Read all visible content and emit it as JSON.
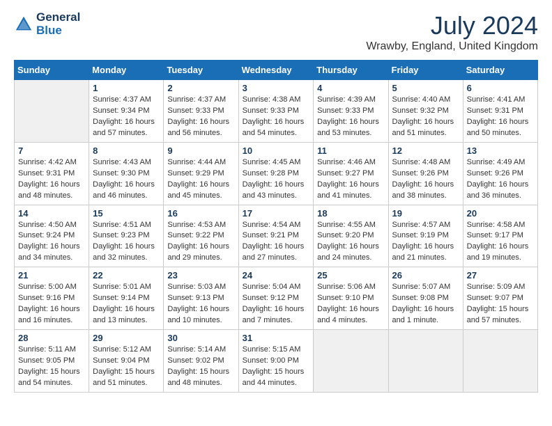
{
  "header": {
    "logo_line1": "General",
    "logo_line2": "Blue",
    "month_year": "July 2024",
    "location": "Wrawby, England, United Kingdom"
  },
  "columns": [
    "Sunday",
    "Monday",
    "Tuesday",
    "Wednesday",
    "Thursday",
    "Friday",
    "Saturday"
  ],
  "weeks": [
    [
      {
        "day": "",
        "sunrise": "",
        "sunset": "",
        "daylight": ""
      },
      {
        "day": "1",
        "sunrise": "Sunrise: 4:37 AM",
        "sunset": "Sunset: 9:34 PM",
        "daylight": "Daylight: 16 hours and 57 minutes."
      },
      {
        "day": "2",
        "sunrise": "Sunrise: 4:37 AM",
        "sunset": "Sunset: 9:33 PM",
        "daylight": "Daylight: 16 hours and 56 minutes."
      },
      {
        "day": "3",
        "sunrise": "Sunrise: 4:38 AM",
        "sunset": "Sunset: 9:33 PM",
        "daylight": "Daylight: 16 hours and 54 minutes."
      },
      {
        "day": "4",
        "sunrise": "Sunrise: 4:39 AM",
        "sunset": "Sunset: 9:33 PM",
        "daylight": "Daylight: 16 hours and 53 minutes."
      },
      {
        "day": "5",
        "sunrise": "Sunrise: 4:40 AM",
        "sunset": "Sunset: 9:32 PM",
        "daylight": "Daylight: 16 hours and 51 minutes."
      },
      {
        "day": "6",
        "sunrise": "Sunrise: 4:41 AM",
        "sunset": "Sunset: 9:31 PM",
        "daylight": "Daylight: 16 hours and 50 minutes."
      }
    ],
    [
      {
        "day": "7",
        "sunrise": "Sunrise: 4:42 AM",
        "sunset": "Sunset: 9:31 PM",
        "daylight": "Daylight: 16 hours and 48 minutes."
      },
      {
        "day": "8",
        "sunrise": "Sunrise: 4:43 AM",
        "sunset": "Sunset: 9:30 PM",
        "daylight": "Daylight: 16 hours and 46 minutes."
      },
      {
        "day": "9",
        "sunrise": "Sunrise: 4:44 AM",
        "sunset": "Sunset: 9:29 PM",
        "daylight": "Daylight: 16 hours and 45 minutes."
      },
      {
        "day": "10",
        "sunrise": "Sunrise: 4:45 AM",
        "sunset": "Sunset: 9:28 PM",
        "daylight": "Daylight: 16 hours and 43 minutes."
      },
      {
        "day": "11",
        "sunrise": "Sunrise: 4:46 AM",
        "sunset": "Sunset: 9:27 PM",
        "daylight": "Daylight: 16 hours and 41 minutes."
      },
      {
        "day": "12",
        "sunrise": "Sunrise: 4:48 AM",
        "sunset": "Sunset: 9:26 PM",
        "daylight": "Daylight: 16 hours and 38 minutes."
      },
      {
        "day": "13",
        "sunrise": "Sunrise: 4:49 AM",
        "sunset": "Sunset: 9:26 PM",
        "daylight": "Daylight: 16 hours and 36 minutes."
      }
    ],
    [
      {
        "day": "14",
        "sunrise": "Sunrise: 4:50 AM",
        "sunset": "Sunset: 9:24 PM",
        "daylight": "Daylight: 16 hours and 34 minutes."
      },
      {
        "day": "15",
        "sunrise": "Sunrise: 4:51 AM",
        "sunset": "Sunset: 9:23 PM",
        "daylight": "Daylight: 16 hours and 32 minutes."
      },
      {
        "day": "16",
        "sunrise": "Sunrise: 4:53 AM",
        "sunset": "Sunset: 9:22 PM",
        "daylight": "Daylight: 16 hours and 29 minutes."
      },
      {
        "day": "17",
        "sunrise": "Sunrise: 4:54 AM",
        "sunset": "Sunset: 9:21 PM",
        "daylight": "Daylight: 16 hours and 27 minutes."
      },
      {
        "day": "18",
        "sunrise": "Sunrise: 4:55 AM",
        "sunset": "Sunset: 9:20 PM",
        "daylight": "Daylight: 16 hours and 24 minutes."
      },
      {
        "day": "19",
        "sunrise": "Sunrise: 4:57 AM",
        "sunset": "Sunset: 9:19 PM",
        "daylight": "Daylight: 16 hours and 21 minutes."
      },
      {
        "day": "20",
        "sunrise": "Sunrise: 4:58 AM",
        "sunset": "Sunset: 9:17 PM",
        "daylight": "Daylight: 16 hours and 19 minutes."
      }
    ],
    [
      {
        "day": "21",
        "sunrise": "Sunrise: 5:00 AM",
        "sunset": "Sunset: 9:16 PM",
        "daylight": "Daylight: 16 hours and 16 minutes."
      },
      {
        "day": "22",
        "sunrise": "Sunrise: 5:01 AM",
        "sunset": "Sunset: 9:14 PM",
        "daylight": "Daylight: 16 hours and 13 minutes."
      },
      {
        "day": "23",
        "sunrise": "Sunrise: 5:03 AM",
        "sunset": "Sunset: 9:13 PM",
        "daylight": "Daylight: 16 hours and 10 minutes."
      },
      {
        "day": "24",
        "sunrise": "Sunrise: 5:04 AM",
        "sunset": "Sunset: 9:12 PM",
        "daylight": "Daylight: 16 hours and 7 minutes."
      },
      {
        "day": "25",
        "sunrise": "Sunrise: 5:06 AM",
        "sunset": "Sunset: 9:10 PM",
        "daylight": "Daylight: 16 hours and 4 minutes."
      },
      {
        "day": "26",
        "sunrise": "Sunrise: 5:07 AM",
        "sunset": "Sunset: 9:08 PM",
        "daylight": "Daylight: 16 hours and 1 minute."
      },
      {
        "day": "27",
        "sunrise": "Sunrise: 5:09 AM",
        "sunset": "Sunset: 9:07 PM",
        "daylight": "Daylight: 15 hours and 57 minutes."
      }
    ],
    [
      {
        "day": "28",
        "sunrise": "Sunrise: 5:11 AM",
        "sunset": "Sunset: 9:05 PM",
        "daylight": "Daylight: 15 hours and 54 minutes."
      },
      {
        "day": "29",
        "sunrise": "Sunrise: 5:12 AM",
        "sunset": "Sunset: 9:04 PM",
        "daylight": "Daylight: 15 hours and 51 minutes."
      },
      {
        "day": "30",
        "sunrise": "Sunrise: 5:14 AM",
        "sunset": "Sunset: 9:02 PM",
        "daylight": "Daylight: 15 hours and 48 minutes."
      },
      {
        "day": "31",
        "sunrise": "Sunrise: 5:15 AM",
        "sunset": "Sunset: 9:00 PM",
        "daylight": "Daylight: 15 hours and 44 minutes."
      },
      {
        "day": "",
        "sunrise": "",
        "sunset": "",
        "daylight": ""
      },
      {
        "day": "",
        "sunrise": "",
        "sunset": "",
        "daylight": ""
      },
      {
        "day": "",
        "sunrise": "",
        "sunset": "",
        "daylight": ""
      }
    ]
  ]
}
